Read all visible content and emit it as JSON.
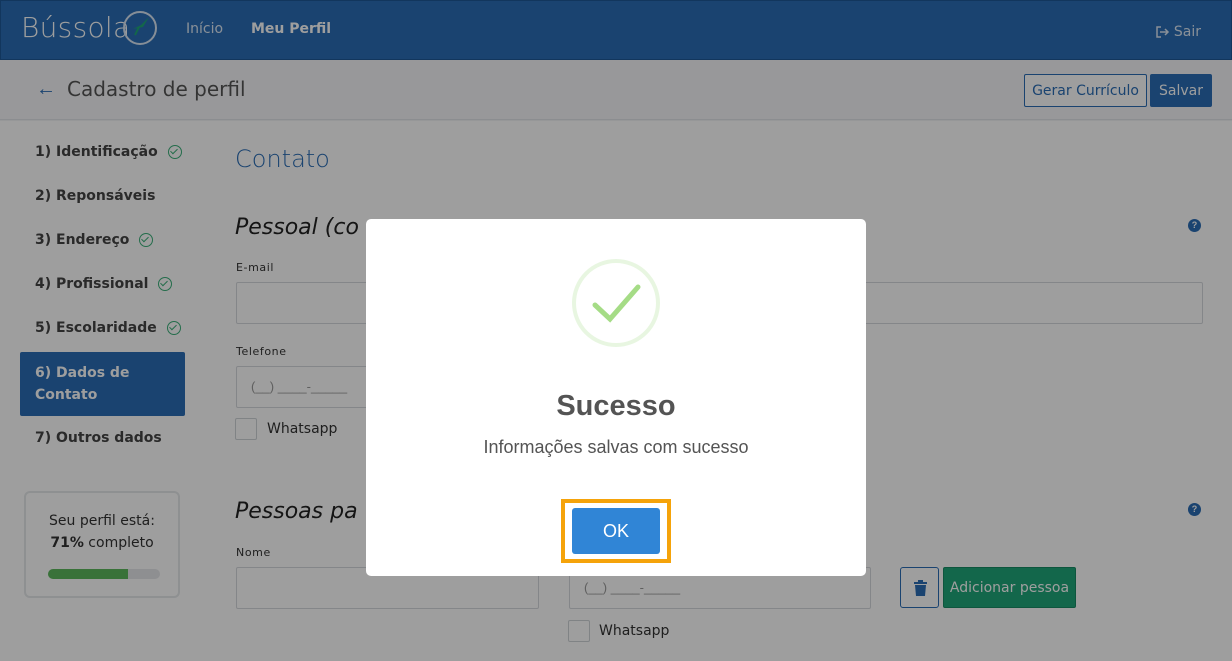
{
  "topnav": {
    "logo": "Bússola",
    "links": [
      {
        "label": "Início"
      },
      {
        "label": "Meu Perfil"
      }
    ],
    "logout": "Sair"
  },
  "subheader": {
    "title": "Cadastro de perfil",
    "generate_cv": "Gerar Currículo",
    "save": "Salvar"
  },
  "sidebar": {
    "steps": [
      {
        "label": "1) Identificação",
        "done": true
      },
      {
        "label": "2) Reponsáveis",
        "done": false
      },
      {
        "label": "3) Endereço",
        "done": true
      },
      {
        "label": "4) Profissional",
        "done": true
      },
      {
        "label": "5) Escolaridade",
        "done": true
      },
      {
        "label": "6) Dados de Contato",
        "active": true
      },
      {
        "label": "7) Outros dados",
        "done": false
      }
    ],
    "progress": {
      "line1": "Seu perfil está:",
      "percent": "71%",
      "suffix": " completo",
      "value": 0.71
    }
  },
  "main": {
    "section_title": "Contato",
    "personal_title": "Pessoal (co",
    "email_label": "E-mail",
    "phone_label": "Telefone",
    "phone_placeholder": "(__) ____-_____",
    "whatsapp": "Whatsapp",
    "people_title": "Pessoas pa",
    "name_label": "Nome",
    "phone2_placeholder": "(__) ____-_____",
    "whatsapp2": "Whatsapp",
    "add_person": "Adicionar pessoa",
    "help": "?"
  },
  "modal": {
    "title": "Sucesso",
    "text": "Informações salvas com sucesso",
    "ok": "OK"
  },
  "colors": {
    "primary": "#2a6db5",
    "success": "#1fa679",
    "focus": "#f5a30a",
    "ok_button": "#3085d6"
  }
}
